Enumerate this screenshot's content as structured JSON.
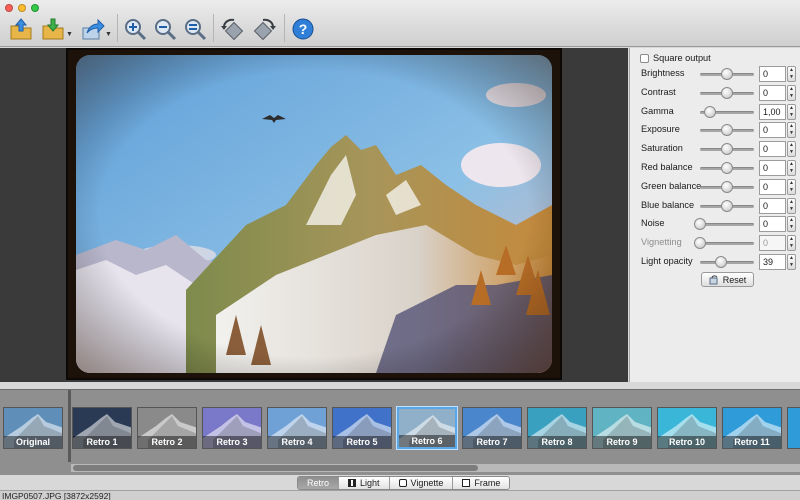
{
  "window": {
    "traffic_lights": {
      "close": "#fc5f57",
      "minimize": "#fdbc2e",
      "zoom": "#34c84a"
    }
  },
  "toolbar": {
    "buttons": [
      {
        "icon": "open-icon"
      },
      {
        "icon": "save-icon"
      },
      {
        "icon": "share-icon"
      },
      {
        "icon": "zoom-in-icon"
      },
      {
        "icon": "zoom-out-icon"
      },
      {
        "icon": "zoom-fit-icon"
      },
      {
        "icon": "rotate-left-icon"
      },
      {
        "icon": "rotate-right-icon"
      },
      {
        "icon": "help-icon"
      }
    ],
    "help_glyph": "?"
  },
  "panel": {
    "square_output_label": "Square output",
    "settings": [
      {
        "label": "Brightness",
        "value": "0",
        "slider_level": 0.5,
        "enabled": true
      },
      {
        "label": "Contrast",
        "value": "0",
        "slider_level": 0.5,
        "enabled": true
      },
      {
        "label": "Gamma",
        "value": "1,00",
        "slider_level": 0.18,
        "enabled": true
      },
      {
        "label": "Exposure",
        "value": "0",
        "slider_level": 0.5,
        "enabled": true
      },
      {
        "label": "Saturation",
        "value": "0",
        "slider_level": 0.5,
        "enabled": true
      },
      {
        "label": "Red balance",
        "value": "0",
        "slider_level": 0.5,
        "enabled": true
      },
      {
        "label": "Green balance",
        "value": "0",
        "slider_level": 0.5,
        "enabled": true
      },
      {
        "label": "Blue balance",
        "value": "0",
        "slider_level": 0.5,
        "enabled": true
      },
      {
        "label": "Noise",
        "value": "0",
        "slider_level": 0.0,
        "enabled": true
      },
      {
        "label": "Vignetting",
        "value": "0",
        "slider_level": 0.0,
        "enabled": false
      },
      {
        "label": "Light opacity",
        "value": "39",
        "slider_level": 0.39,
        "enabled": true
      }
    ],
    "reset_label": "Reset",
    "stepper_up": "▲",
    "stepper_down": "▼"
  },
  "filters": [
    {
      "label": "Original",
      "tint": "#5f8fb8",
      "selected": false
    },
    {
      "label": "Retro 1",
      "tint": "#2a3a55",
      "selected": false
    },
    {
      "label": "Retro 2",
      "tint": "#8a8a8a",
      "selected": false
    },
    {
      "label": "Retro 3",
      "tint": "#7a78c8",
      "selected": false
    },
    {
      "label": "Retro 4",
      "tint": "#6fa0d6",
      "selected": false
    },
    {
      "label": "Retro 5",
      "tint": "#3f72c8",
      "selected": false
    },
    {
      "label": "Retro 6",
      "tint": "#8fb0c8",
      "selected": true
    },
    {
      "label": "Retro 7",
      "tint": "#4a86cc",
      "selected": false
    },
    {
      "label": "Retro 8",
      "tint": "#3aa0c0",
      "selected": false
    },
    {
      "label": "Retro 9",
      "tint": "#5fb3c2",
      "selected": false
    },
    {
      "label": "Retro 10",
      "tint": "#39b6d8",
      "selected": false
    },
    {
      "label": "Retro 11",
      "tint": "#2f9bd8",
      "selected": false
    }
  ],
  "tabs": [
    {
      "label": "Retro",
      "icon": "",
      "active": true
    },
    {
      "label": "Light",
      "icon": "light-icon",
      "active": false
    },
    {
      "label": "Vignette",
      "icon": "vignette-icon",
      "active": false
    },
    {
      "label": "Frame",
      "icon": "frame-icon",
      "active": false
    }
  ],
  "status": {
    "text": "IMGP0507.JPG [3872x2592]"
  }
}
